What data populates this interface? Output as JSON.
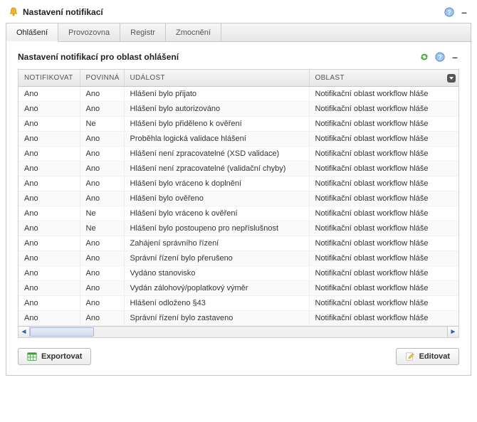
{
  "window": {
    "title": "Nastavení notifikací"
  },
  "tabs": [
    {
      "label": "Ohlášení",
      "active": true
    },
    {
      "label": "Provozovna",
      "active": false
    },
    {
      "label": "Registr",
      "active": false
    },
    {
      "label": "Zmocnění",
      "active": false
    }
  ],
  "panel": {
    "subtitle": "Nastavení notifikací pro oblast ohlášení"
  },
  "columns": {
    "notifikovat": "NOTIFIKOVAT",
    "povinna": "POVINNÁ",
    "udalost": "UDÁLOST",
    "oblast": "OBLAST"
  },
  "rows": [
    {
      "notif": "Ano",
      "pov": "Ano",
      "ud": "Hlášení bylo přijato",
      "ob": "Notifikační oblast workflow hláše"
    },
    {
      "notif": "Ano",
      "pov": "Ano",
      "ud": "Hlášení bylo autorizováno",
      "ob": "Notifikační oblast workflow hláše"
    },
    {
      "notif": "Ano",
      "pov": "Ne",
      "ud": "Hlášení bylo přiděleno k ověření",
      "ob": "Notifikační oblast workflow hláše"
    },
    {
      "notif": "Ano",
      "pov": "Ano",
      "ud": "Proběhla logická validace hlášení",
      "ob": "Notifikační oblast workflow hláše"
    },
    {
      "notif": "Ano",
      "pov": "Ano",
      "ud": "Hlášení není zpracovatelné (XSD validace)",
      "ob": "Notifikační oblast workflow hláše"
    },
    {
      "notif": "Ano",
      "pov": "Ano",
      "ud": "Hlášení není zpracovatelné (validační chyby)",
      "ob": "Notifikační oblast workflow hláše"
    },
    {
      "notif": "Ano",
      "pov": "Ano",
      "ud": "Hlášení bylo vráceno k doplnění",
      "ob": "Notifikační oblast workflow hláše"
    },
    {
      "notif": "Ano",
      "pov": "Ano",
      "ud": "Hlášení bylo ověřeno",
      "ob": "Notifikační oblast workflow hláše"
    },
    {
      "notif": "Ano",
      "pov": "Ne",
      "ud": "Hlášení bylo vráceno k ověření",
      "ob": "Notifikační oblast workflow hláše"
    },
    {
      "notif": "Ano",
      "pov": "Ne",
      "ud": "Hlášení bylo postoupeno pro nepříslušnost",
      "ob": "Notifikační oblast workflow hláše"
    },
    {
      "notif": "Ano",
      "pov": "Ano",
      "ud": "Zahájení správního řízení",
      "ob": "Notifikační oblast workflow hláše"
    },
    {
      "notif": "Ano",
      "pov": "Ano",
      "ud": "Správní řízení bylo přerušeno",
      "ob": "Notifikační oblast workflow hláše"
    },
    {
      "notif": "Ano",
      "pov": "Ano",
      "ud": "Vydáno stanovisko",
      "ob": "Notifikační oblast workflow hláše"
    },
    {
      "notif": "Ano",
      "pov": "Ano",
      "ud": "Vydán zálohový/poplatkový výměr",
      "ob": "Notifikační oblast workflow hláše"
    },
    {
      "notif": "Ano",
      "pov": "Ano",
      "ud": "Hlášení odloženo §43",
      "ob": "Notifikační oblast workflow hláše"
    },
    {
      "notif": "Ano",
      "pov": "Ano",
      "ud": "Správní řízení bylo zastaveno",
      "ob": "Notifikační oblast workflow hláše"
    }
  ],
  "buttons": {
    "export": "Exportovat",
    "edit": "Editovat"
  }
}
